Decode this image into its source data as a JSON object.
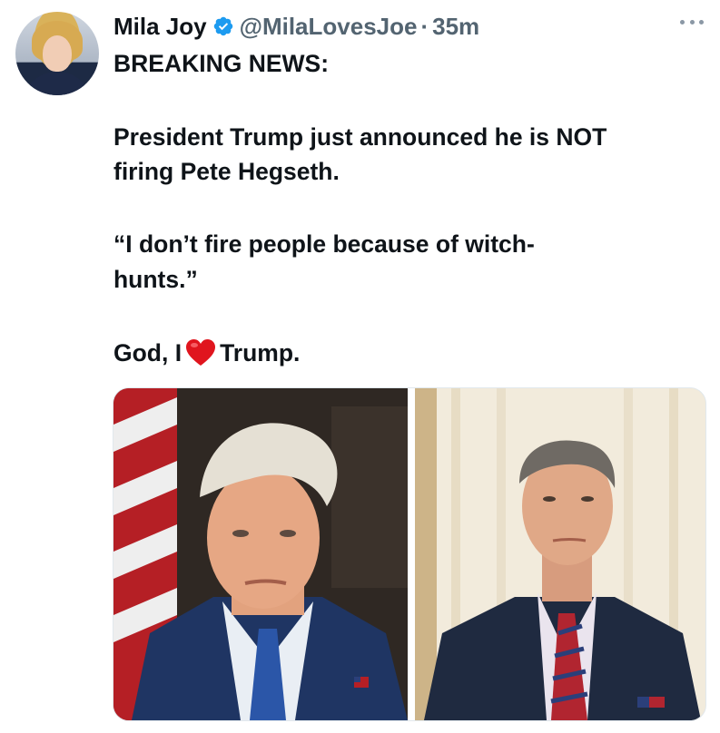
{
  "author": {
    "name": "Mila Joy",
    "handle": "@MilaLovesJoe",
    "separator": "·",
    "time": "35m",
    "verified": true
  },
  "tweet": {
    "line1": "BREAKING NEWS:",
    "line2": "President Trump just announced he is NOT",
    "line3": "firing Pete Hegseth.",
    "line4": "“I don’t fire people because of witch-",
    "line5": "hunts.”",
    "line6_before": "God, I",
    "line6_after": "Trump."
  },
  "icons": {
    "verified": "verified-badge-icon",
    "more": "more-options-icon",
    "heart": "red-heart-emoji"
  },
  "colors": {
    "text": "#0f1419",
    "secondary": "#536471",
    "verified": "#1d9bf0",
    "heart": "#e0151e"
  }
}
